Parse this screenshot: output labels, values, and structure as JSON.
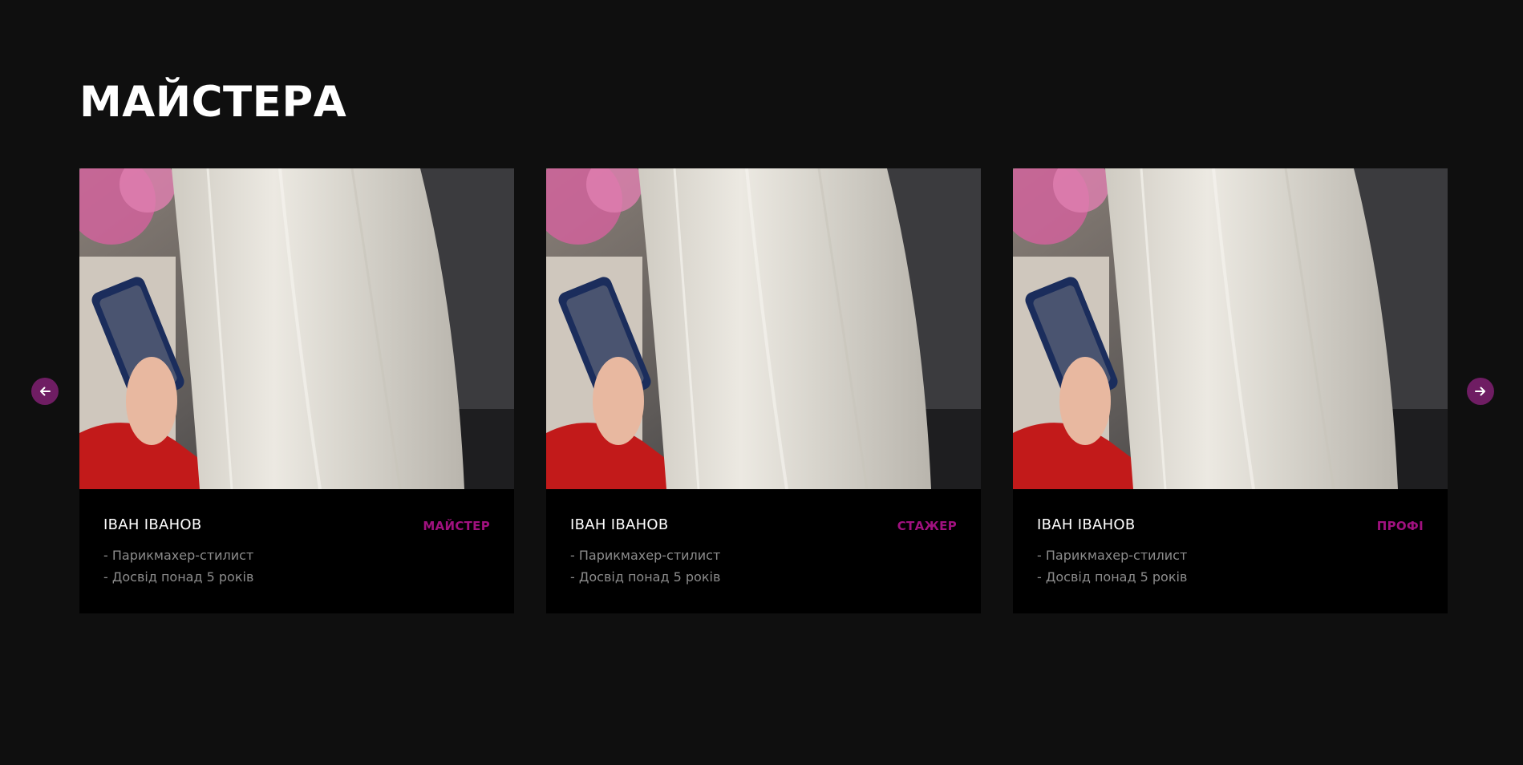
{
  "section": {
    "title": "МАЙСТЕРА"
  },
  "navigation": {
    "prev_icon": "arrow-left-icon",
    "next_icon": "arrow-right-icon",
    "accent_color": "#6f1d63"
  },
  "colors": {
    "background": "#0f0f0f",
    "card_background": "#000000",
    "badge": "#a0117f",
    "muted_text": "#8c8c8c"
  },
  "cards": [
    {
      "name": "ІВАН ІВАНОВ",
      "badge": "МАЙСТЕР",
      "lines": [
        "- Парикмахер-стилист",
        "- Досвід понад 5 років"
      ]
    },
    {
      "name": "ІВАН ІВАНОВ",
      "badge": "СТАЖЕР",
      "lines": [
        "- Парикмахер-стилист",
        "- Досвід понад 5 років"
      ]
    },
    {
      "name": "ІВАН ІВАНОВ",
      "badge": "ПРОФІ",
      "lines": [
        "- Парикмахер-стилист",
        "- Досвід понад 5 років"
      ]
    }
  ]
}
